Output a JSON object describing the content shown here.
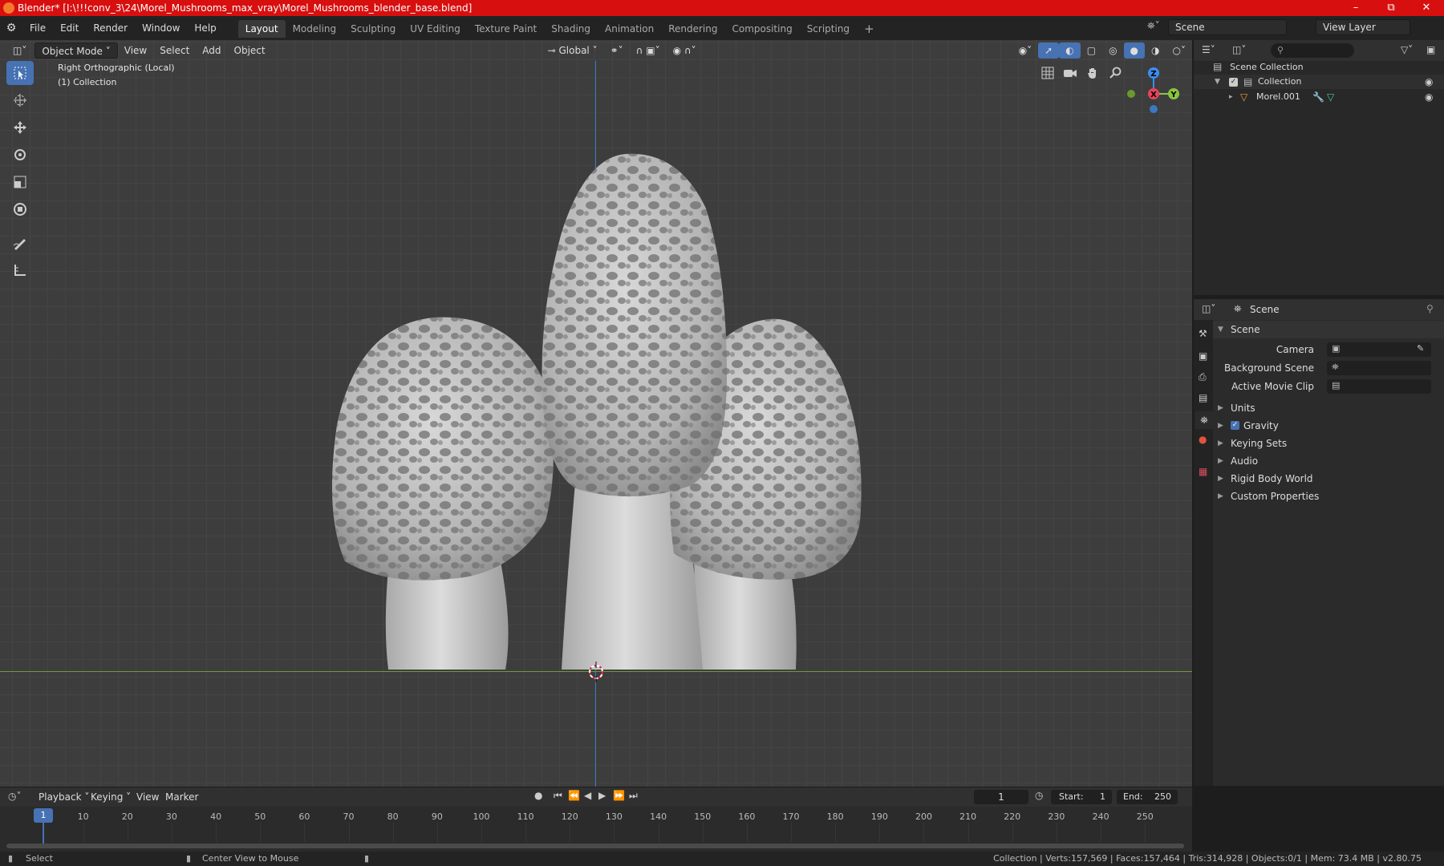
{
  "titlebar": {
    "title": "Blender* [I:\\!!!conv_3\\24\\Morel_Mushrooms_max_vray\\Morel_Mushrooms_blender_base.blend]"
  },
  "menu": [
    "File",
    "Edit",
    "Render",
    "Window",
    "Help"
  ],
  "workspaces": [
    "Layout",
    "Modeling",
    "Sculpting",
    "UV Editing",
    "Texture Paint",
    "Shading",
    "Animation",
    "Rendering",
    "Compositing",
    "Scripting"
  ],
  "topright": {
    "scene": "Scene",
    "view_layer": "View Layer"
  },
  "viewport_header": {
    "mode": "Object Mode",
    "menus": [
      "View",
      "Select",
      "Add",
      "Object"
    ],
    "orientation": "Global"
  },
  "viewport": {
    "view_name": "Right Orthographic (Local)",
    "collection": "(1) Collection"
  },
  "gizmo": {
    "z": "Z",
    "x": "X",
    "y": "Y"
  },
  "outliner": {
    "root": "Scene Collection",
    "collection": "Collection",
    "object": "Morel.001"
  },
  "properties": {
    "header": "Scene",
    "panel": "Scene",
    "fields": {
      "camera": "Camera",
      "background_scene": "Background Scene",
      "active_movie_clip": "Active Movie Clip"
    },
    "sections": [
      "Units",
      "Gravity",
      "Keying Sets",
      "Audio",
      "Rigid Body World",
      "Custom Properties"
    ]
  },
  "timeline": {
    "menus": [
      "Playback",
      "Keying",
      "View",
      "Marker"
    ],
    "current_frame": "1",
    "start_label": "Start:",
    "start": "1",
    "end_label": "End:",
    "end": "250",
    "ticks": [
      "1",
      "10",
      "20",
      "30",
      "40",
      "50",
      "60",
      "70",
      "80",
      "90",
      "100",
      "110",
      "120",
      "130",
      "140",
      "150",
      "160",
      "170",
      "180",
      "190",
      "200",
      "210",
      "220",
      "230",
      "240",
      "250"
    ]
  },
  "statusbar": {
    "left": "Select",
    "middle": "Center View to Mouse",
    "right": "Collection | Verts:157,569 | Faces:157,464 | Tris:314,928 | Objects:0/1 | Mem: 73.4 MB | v2.80.75"
  },
  "colors": {
    "accent": "#4772b3",
    "title_red": "#d70f0f",
    "x_axis": "#e8435a",
    "y_axis": "#8bc53f",
    "z_axis": "#3c8ef0"
  }
}
